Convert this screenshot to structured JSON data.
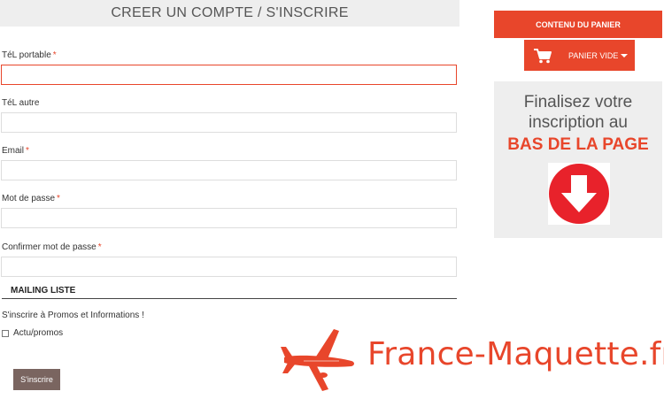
{
  "form": {
    "title": "CREER UN COMPTE / S'INSCRIRE",
    "fields": [
      {
        "label": "TéL portable",
        "required": "*",
        "value": "",
        "placeholder": ""
      },
      {
        "label": "TéL autre",
        "required": "",
        "value": "",
        "placeholder": ""
      },
      {
        "label": "Email",
        "required": "*",
        "value": "",
        "placeholder": ""
      },
      {
        "label": "Mot de passe",
        "required": "*",
        "value": "",
        "placeholder": ""
      },
      {
        "label": "Confirmer mot de passe",
        "required": "*",
        "value": "",
        "placeholder": ""
      }
    ],
    "mailing": {
      "title": "MAILING LISTE",
      "description": "S'inscrire à Promos et Informations !",
      "checkbox_label": "Actu/promos",
      "checked": false
    },
    "submit_label": "S'inscrire"
  },
  "cart": {
    "header": "CONTENU DU PANIER",
    "button_label": "PANIER VIDE",
    "icon": "cart-icon"
  },
  "promo": {
    "line1": "Finalisez votre",
    "line2": "inscription au",
    "line3": "BAS DE LA PAGE",
    "icon": "arrow-down-circle-icon"
  },
  "logo": {
    "text": "France-Maquette.fr",
    "icon": "airplane-icon"
  },
  "colors": {
    "accent": "#e8462b",
    "panel_bg": "#eeeeee",
    "button_bg": "#7a6560"
  }
}
